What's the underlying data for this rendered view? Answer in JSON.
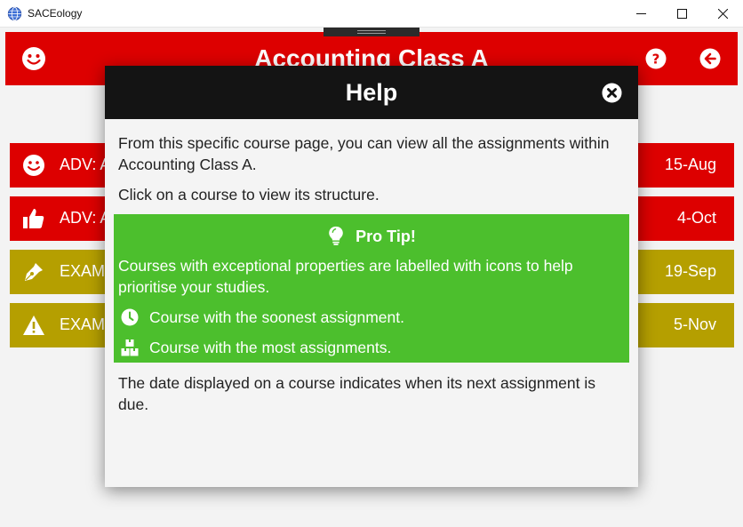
{
  "window": {
    "title": "SACEology",
    "minimize": "─",
    "maximize": "☐",
    "close": "✕"
  },
  "header": {
    "title": "Accounting Class A",
    "left_icon": "smiley-icon",
    "help_icon": "help-icon",
    "back_icon": "back-arrow-icon"
  },
  "courses": [
    {
      "label": "ADV: A",
      "date": "15-Aug",
      "icon": "smiley-icon",
      "color": "#dd0000"
    },
    {
      "label": "ADV: A",
      "date": "4-Oct",
      "icon": "thumbs-up-icon",
      "color": "#dd0000"
    },
    {
      "label": "EXAM",
      "date": "19-Sep",
      "icon": "pen-nib-icon",
      "color": "#b59f00"
    },
    {
      "label": "EXAM",
      "date": "5-Nov",
      "icon": "warning-icon",
      "color": "#b59f00"
    }
  ],
  "help": {
    "title": "Help",
    "intro": "From this specific course page, you can view all the assignments within Accounting Class A.",
    "click_text": "Click on a course to view its structure.",
    "tip": {
      "heading": "Pro Tip!",
      "text": "Courses with exceptional properties are labelled with icons to help prioritise your studies.",
      "items": [
        {
          "icon": "clock-icon",
          "text": "Course with the soonest assignment."
        },
        {
          "icon": "boxes-icon",
          "text": "Course with the most assignments."
        }
      ]
    },
    "footer": "The date displayed on a course indicates when its next assignment is due."
  },
  "colors": {
    "header": "#dd0000",
    "urgent": "#dd0000",
    "exam": "#b59f00",
    "tip": "#4cbf2d",
    "modal_header": "#141414"
  }
}
